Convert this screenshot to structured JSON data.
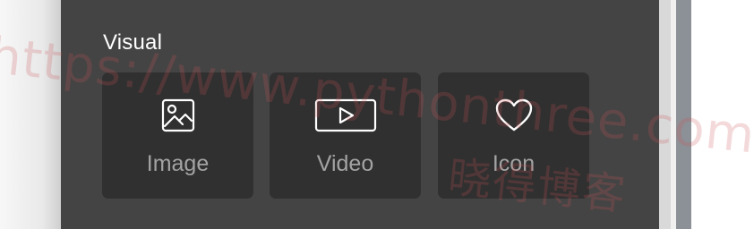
{
  "section": {
    "title": "Visual"
  },
  "tiles": [
    {
      "label": "Image",
      "icon": "image-icon"
    },
    {
      "label": "Video",
      "icon": "video-icon"
    },
    {
      "label": "Icon",
      "icon": "heart-icon"
    }
  ],
  "watermark": {
    "url": "https://www.pythonthree.com",
    "cn": "晓得博客"
  },
  "colors": {
    "panel_bg": "#444444",
    "tile_bg": "#303030",
    "title_text": "#ffffff",
    "label_text": "#a3a3a3",
    "watermark": "#cd5055"
  }
}
